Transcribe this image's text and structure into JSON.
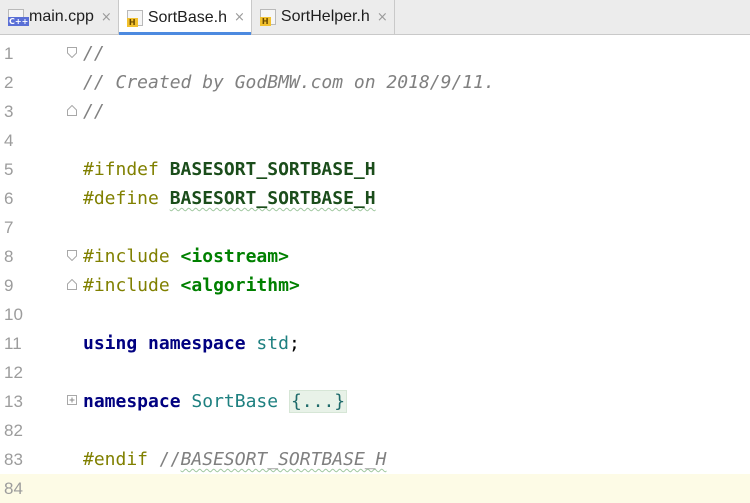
{
  "tabs": [
    {
      "label": "main.cpp",
      "icon": "cpp-file-icon",
      "icon_text": "C++",
      "active": false
    },
    {
      "label": "SortBase.h",
      "icon": "header-file-icon",
      "icon_text": "H",
      "active": true
    },
    {
      "label": "SortHelper.h",
      "icon": "header-file-icon",
      "icon_text": "H",
      "active": false
    }
  ],
  "close_glyph": "×",
  "lines": [
    {
      "num": "1"
    },
    {
      "num": "2"
    },
    {
      "num": "3"
    },
    {
      "num": "4"
    },
    {
      "num": "5"
    },
    {
      "num": "6"
    },
    {
      "num": "7"
    },
    {
      "num": "8"
    },
    {
      "num": "9"
    },
    {
      "num": "10"
    },
    {
      "num": "11"
    },
    {
      "num": "12"
    },
    {
      "num": "13"
    },
    {
      "num": "82"
    },
    {
      "num": "83"
    },
    {
      "num": "84"
    }
  ],
  "code": {
    "l1": "//",
    "l2": "// Created by GodBMW.com on 2018/9/11.",
    "l3": "//",
    "l5_dir": "#ifndef",
    "l5_macro": "BASESORT_SORTBASE_H",
    "l6_dir": "#define",
    "l6_macro": "BASESORT_SORTBASE_H",
    "l8_dir": "#include",
    "l8_lt": "<",
    "l8_name": "iostream",
    "l8_gt": ">",
    "l9_dir": "#include",
    "l9_lt": "<",
    "l9_name": "algorithm",
    "l9_gt": ">",
    "l11_kw1": "using",
    "l11_kw2": "namespace",
    "l11_ns": "std",
    "l11_semi": ";",
    "l13_kw": "namespace",
    "l13_name": "SortBase",
    "l13_folded": "{...}",
    "l83_dir": "#endif",
    "l83_comment_slashes": "//",
    "l83_comment_text": "BASESORT_SORTBASE_H"
  },
  "colors": {
    "comment": "#808080",
    "preprocessor": "#808000",
    "macro": "#1b4d1b",
    "include_name": "#008000",
    "keyword": "#000080",
    "namespace_ref": "#1e8080",
    "current_line": "#fdfbe6",
    "active_tab_accent": "#4d8ae0"
  }
}
